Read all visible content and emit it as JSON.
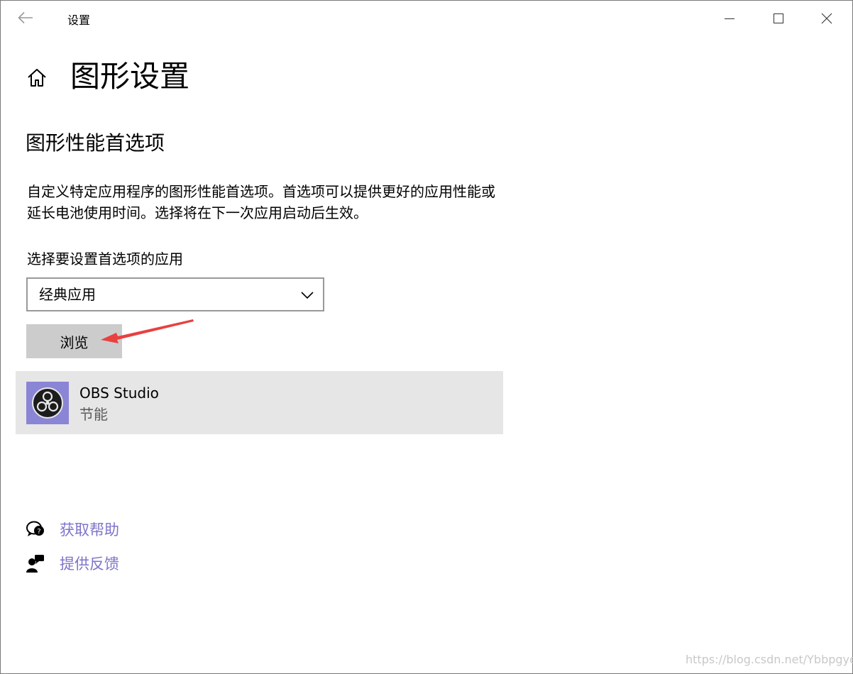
{
  "window": {
    "title": "设置",
    "back_icon": "back-arrow-icon",
    "minimize_icon": "minimize-icon",
    "maximize_icon": "maximize-icon",
    "close_icon": "close-icon"
  },
  "header": {
    "home_icon": "home-icon",
    "title": "图形设置"
  },
  "section": {
    "title": "图形性能首选项",
    "description": "自定义特定应用程序的图形性能首选项。首选项可以提供更好的应用性能或延长电池使用时间。选择将在下一次应用启动后生效。",
    "select_label": "选择要设置首选项的应用",
    "select_value": "经典应用",
    "browse_label": "浏览"
  },
  "apps": [
    {
      "name": "OBS Studio",
      "mode": "节能",
      "icon": "obs-studio-icon"
    }
  ],
  "links": {
    "help_label": "获取帮助",
    "feedback_label": "提供反馈"
  },
  "colors": {
    "link": "#7d74c9",
    "button_bg": "#cccccc",
    "selected_item_bg": "#e6e6e6",
    "annotation_arrow": "#e94040",
    "obs_icon_bg": "#8b85d6"
  },
  "watermark": "https://blog.csdn.net/Ybbpgyeee"
}
